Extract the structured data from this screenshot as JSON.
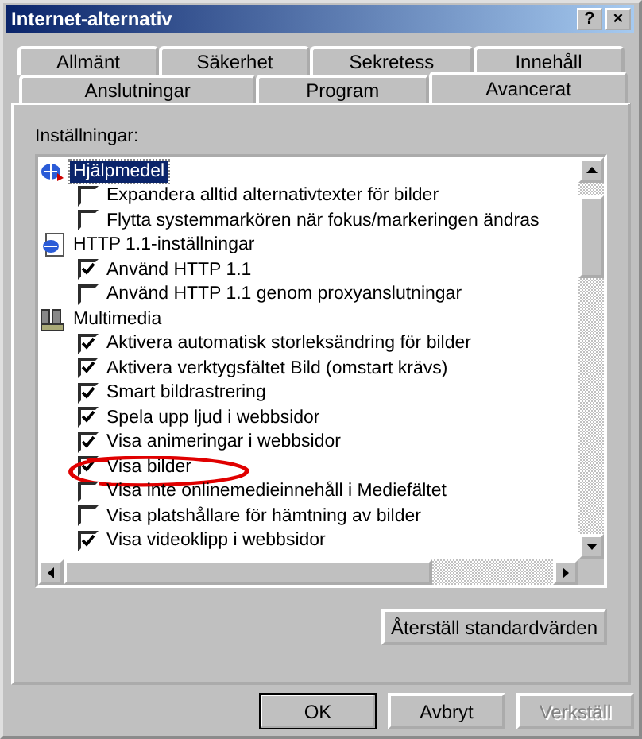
{
  "window": {
    "title": "Internet-alternativ",
    "title_buttons": [
      "?",
      "×"
    ]
  },
  "tab_rows": [
    [
      {
        "label": "Allmänt",
        "selected": false
      },
      {
        "label": "Säkerhet",
        "selected": false
      },
      {
        "label": "Sekretess",
        "selected": false
      },
      {
        "label": "Innehåll",
        "selected": false
      }
    ],
    [
      {
        "label": "Anslutningar",
        "selected": false
      },
      {
        "label": "Program",
        "selected": false
      },
      {
        "label": "Avancerat",
        "selected": true
      }
    ]
  ],
  "settings_label": "Inställningar:",
  "groups": [
    {
      "label": "Hjälpmedel",
      "selected": true,
      "children": [
        {
          "label": "Expandera alltid alternativtexter för bilder",
          "checked": false,
          "circled": false
        },
        {
          "label": "Flytta systemmarkören när fokus/markeringen ändras",
          "checked": false,
          "circled": false
        }
      ]
    },
    {
      "label": "HTTP 1.1-inställningar",
      "selected": false,
      "children": [
        {
          "label": "Använd HTTP 1.1",
          "checked": true,
          "circled": false
        },
        {
          "label": "Använd HTTP 1.1 genom proxyanslutningar",
          "checked": false,
          "circled": false
        }
      ]
    },
    {
      "label": "Multimedia",
      "selected": false,
      "children": [
        {
          "label": "Aktivera automatisk storleksändring för bilder",
          "checked": true,
          "circled": false
        },
        {
          "label": "Aktivera verktygsfältet Bild (omstart krävs)",
          "checked": true,
          "circled": false
        },
        {
          "label": "Smart bildrastrering",
          "checked": true,
          "circled": false
        },
        {
          "label": "Spela upp ljud i webbsidor",
          "checked": true,
          "circled": false
        },
        {
          "label": "Visa animeringar i webbsidor",
          "checked": true,
          "circled": false
        },
        {
          "label": "Visa bilder",
          "checked": true,
          "circled": true
        },
        {
          "label": "Visa inte onlinemedieinnehåll i Mediefältet",
          "checked": false,
          "circled": false
        },
        {
          "label": "Visa platshållare för hämtning av bilder",
          "checked": false,
          "circled": false
        },
        {
          "label": "Visa videoklipp i webbsidor",
          "checked": true,
          "circled": false
        }
      ]
    }
  ],
  "reset_button": "Återställ standardvärden",
  "buttons": [
    {
      "label": "OK",
      "kind": "default",
      "disabled": false
    },
    {
      "label": "Avbryt",
      "kind": "normal",
      "disabled": false
    },
    {
      "label": "Verkställ",
      "kind": "normal",
      "disabled": true
    }
  ]
}
